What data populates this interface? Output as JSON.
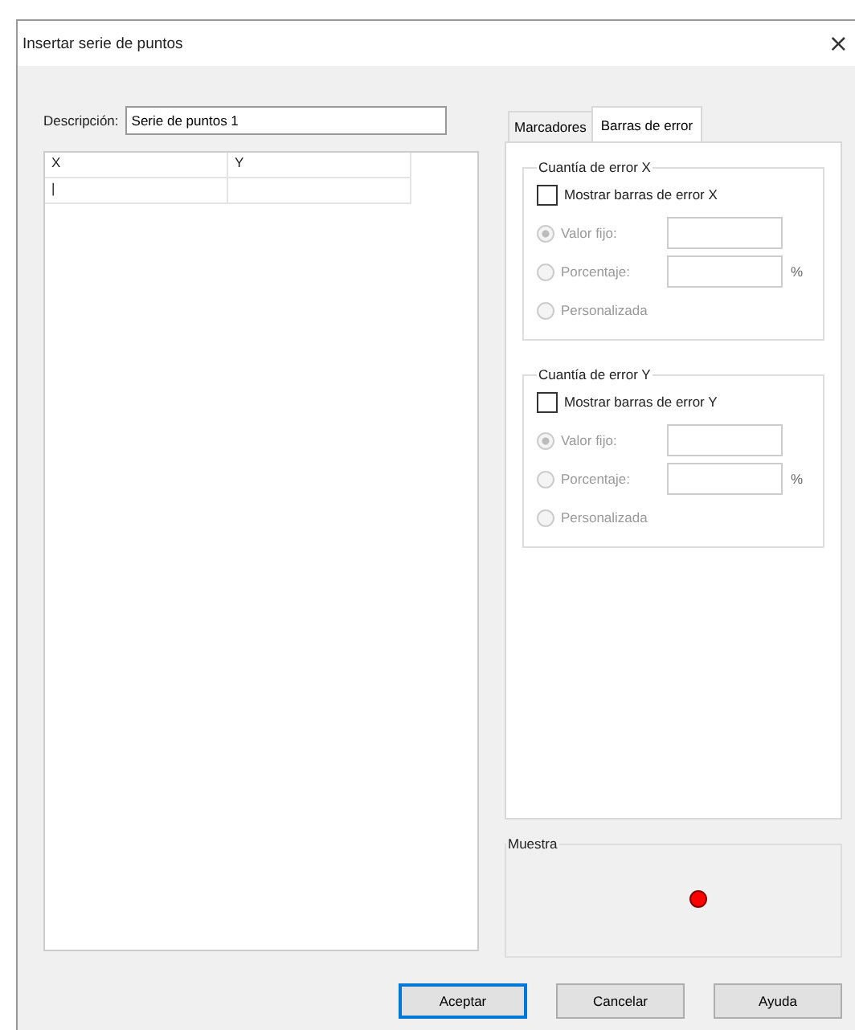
{
  "window": {
    "title": "Insertar serie de puntos",
    "close": "×"
  },
  "description": {
    "label": "Descripción:",
    "value": "Serie de puntos 1"
  },
  "table": {
    "columns": [
      "X",
      "Y"
    ],
    "cursor": "|"
  },
  "tabs": [
    {
      "label": "Marcadores",
      "selected": false
    },
    {
      "label": "Barras de error",
      "selected": true
    }
  ],
  "error_groups": [
    {
      "title": "Cuantía de error X",
      "checkbox": {
        "label": "Mostrar barras de error X",
        "checked": false
      },
      "options": [
        {
          "label": "Valor fijo:",
          "selected": true,
          "disabled": true,
          "kind": "field"
        },
        {
          "label": "Porcentaje:",
          "selected": false,
          "disabled": true,
          "kind": "percent",
          "unit": "%"
        },
        {
          "label": "Personalizada",
          "selected": false,
          "disabled": true,
          "kind": "plain"
        }
      ]
    },
    {
      "title": "Cuantía de error Y",
      "checkbox": {
        "label": "Mostrar barras de error Y",
        "checked": false
      },
      "options": [
        {
          "label": "Valor fijo:",
          "selected": true,
          "disabled": true,
          "kind": "field"
        },
        {
          "label": "Porcentaje:",
          "selected": false,
          "disabled": true,
          "kind": "percent",
          "unit": "%"
        },
        {
          "label": "Personalizada",
          "selected": false,
          "disabled": true,
          "kind": "plain"
        }
      ]
    }
  ],
  "sample": {
    "title": "Muestra",
    "color": "#ff0000"
  },
  "buttons": [
    {
      "label": "Aceptar",
      "default": true
    },
    {
      "label": "Cancelar",
      "default": false
    },
    {
      "label": "Ayuda",
      "default": false
    }
  ]
}
